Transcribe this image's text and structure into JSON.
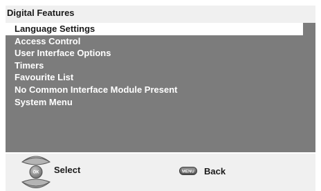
{
  "header": {
    "title": "Digital Features"
  },
  "menu": {
    "selected_index": 0,
    "items": [
      {
        "label": "Language Settings"
      },
      {
        "label": "Access Control"
      },
      {
        "label": "User Interface Options"
      },
      {
        "label": "Timers"
      },
      {
        "label": "Favourite List"
      },
      {
        "label": "No Common Interface Module Present"
      },
      {
        "label": "System Menu"
      }
    ]
  },
  "footer": {
    "ok_key_text": "OK",
    "select_label": "Select",
    "menu_key_text": "MENU",
    "back_label": "Back"
  },
  "colors": {
    "panel_background": "#7c7c7c",
    "title_bar_background": "#f0f0f0",
    "selection_highlight": "#ffffff",
    "item_text": "#ffffff",
    "selected_text": "#1a1a1a"
  },
  "icons": {
    "up": "up-arrow-icon",
    "ok": "ok-button-icon",
    "down": "down-arrow-icon",
    "menu": "menu-key-icon"
  }
}
